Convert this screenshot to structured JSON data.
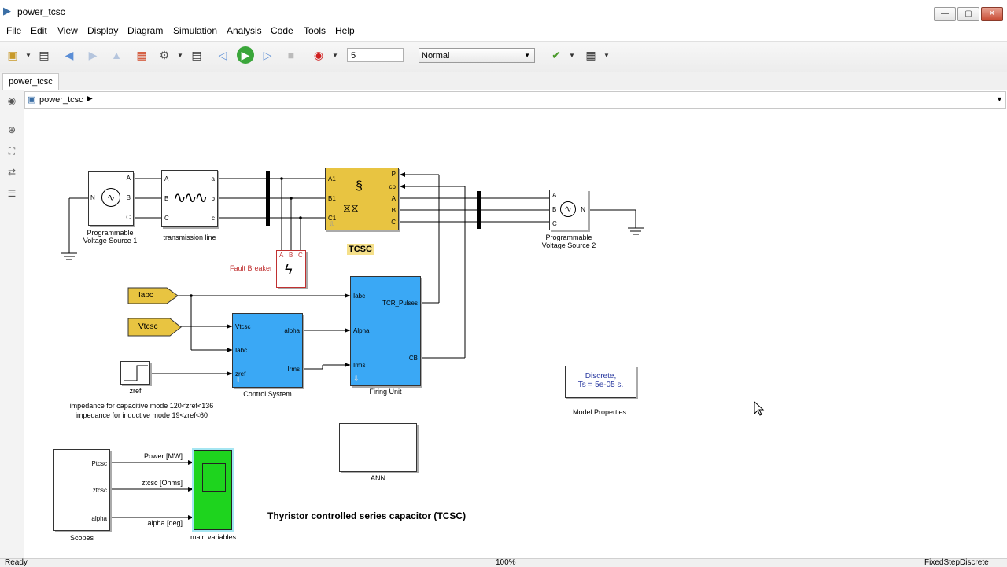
{
  "window": {
    "title": "power_tcsc",
    "min": "—",
    "max": "▢",
    "close": "✕"
  },
  "menu": [
    "File",
    "Edit",
    "View",
    "Display",
    "Diagram",
    "Simulation",
    "Analysis",
    "Code",
    "Tools",
    "Help"
  ],
  "toolbar": {
    "stop_time": "5",
    "sim_mode": "Normal"
  },
  "tab": {
    "label": "power_tcsc"
  },
  "breadcrumb": {
    "label": "power_tcsc"
  },
  "status": {
    "left": "Ready",
    "zoom": "100%",
    "solver": "FixedStepDiscrete"
  },
  "diagram": {
    "title": "Thyristor controlled series capacitor (TCSC)",
    "blocks": {
      "pvs1": {
        "label1": "Programmable",
        "label2": "Voltage Source 1",
        "port_n": "N",
        "ports": [
          "A",
          "B",
          "C"
        ]
      },
      "tline": {
        "label": "transmission line",
        "ports_in": [
          "A",
          "B",
          "C"
        ],
        "ports_out": [
          "a",
          "b",
          "c"
        ]
      },
      "tcsc": {
        "label": "TCSC",
        "ports_in": [
          "A1",
          "B1",
          "C1"
        ],
        "ports_out": [
          "P",
          "cb",
          "A",
          "B",
          "C"
        ]
      },
      "pvs2": {
        "label1": "Programmable",
        "label2": "Voltage Source 2",
        "port_n": "N",
        "ports": [
          "A",
          "B",
          "C"
        ]
      },
      "fault": {
        "label": "Fault Breaker",
        "ports": [
          "A",
          "B",
          "C"
        ]
      },
      "iabc": {
        "label": "Iabc"
      },
      "vtcsc": {
        "label": "Vtcsc"
      },
      "control": {
        "label": "Control System",
        "inputs": [
          "Vtcsc",
          "Iabc",
          "zref"
        ],
        "outputs": [
          "alpha",
          "Irms"
        ]
      },
      "firing": {
        "label": "Firing Unit",
        "inputs": [
          "Iabc",
          "Alpha",
          "Irms"
        ],
        "outputs": [
          "TCR_Pulses",
          "CB"
        ]
      },
      "zref": {
        "label": "zref",
        "note1": "impedance for capacitive mode 120<zref<136",
        "note2": "impedance for inductive mode 19<zref<60"
      },
      "discrete": {
        "line1": "Discrete,",
        "line2": "Ts = 5e-05 s.",
        "label": "Model Properties"
      },
      "ann": {
        "label": "ANN"
      },
      "scopes": {
        "label": "Scopes",
        "ports": [
          "Ptcsc",
          "ztcsc",
          "alpha"
        ]
      },
      "mainvars": {
        "label": "main variables"
      },
      "signals": [
        "Power [MW]",
        "ztcsc [Ohms]",
        "alpha [deg]"
      ]
    }
  }
}
